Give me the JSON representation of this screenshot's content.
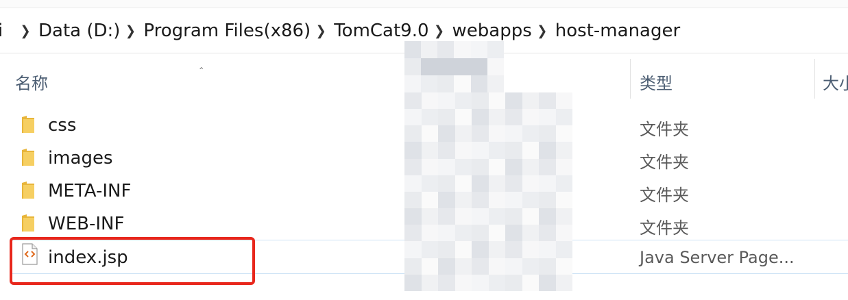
{
  "breadcrumb": {
    "edge_fragment": "i",
    "items": [
      "Data (D:)",
      "Program Files(x86)",
      "TomCat9.0",
      "webapps",
      "host-manager"
    ]
  },
  "columns": {
    "name": "名称",
    "type": "类型",
    "size": "大小"
  },
  "files": [
    {
      "name": "css",
      "type": "文件夹",
      "icon": "folder-icon"
    },
    {
      "name": "images",
      "type": "文件夹",
      "icon": "folder-icon"
    },
    {
      "name": "META-INF",
      "type": "文件夹",
      "icon": "folder-icon"
    },
    {
      "name": "WEB-INF",
      "type": "文件夹",
      "icon": "folder-icon"
    },
    {
      "name": "index.jsp",
      "type": "Java Server Page...",
      "icon": "jsp-file-icon",
      "selected": true
    }
  ],
  "colors": {
    "highlight": "#e8271c",
    "folder": "#f2c24a",
    "header_text": "#4c5e73",
    "selection_border": "#cde3f5"
  }
}
